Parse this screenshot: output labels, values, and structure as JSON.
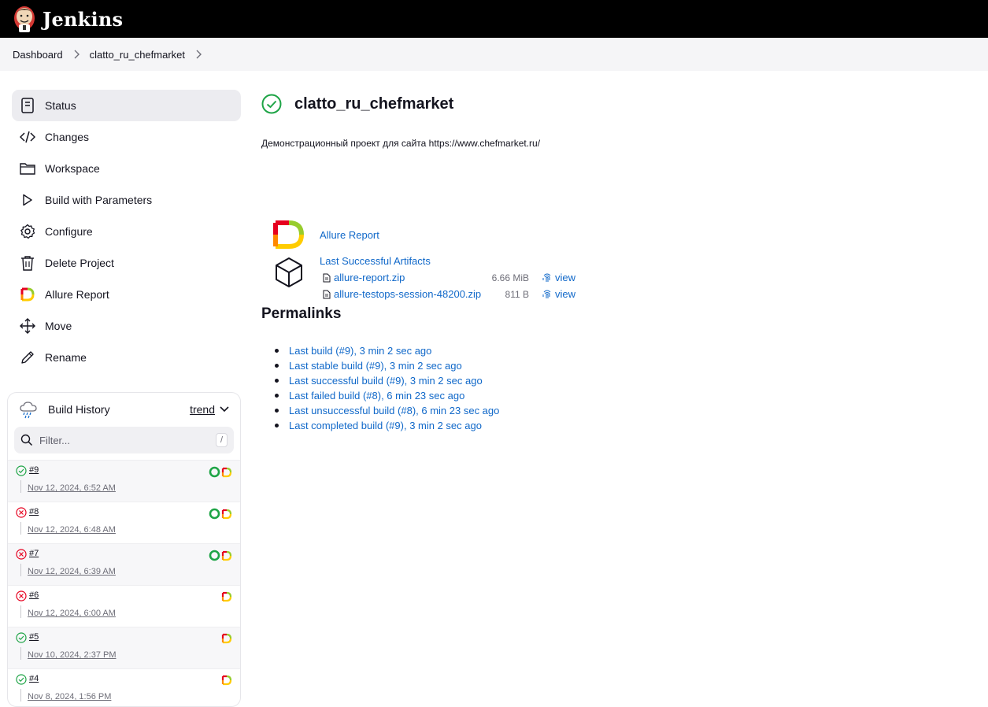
{
  "header": {
    "app_name": "Jenkins"
  },
  "breadcrumbs": [
    "Dashboard",
    "clatto_ru_chefmarket"
  ],
  "sidebar": {
    "items": [
      {
        "label": "Status",
        "icon": "status-icon"
      },
      {
        "label": "Changes",
        "icon": "code-icon"
      },
      {
        "label": "Workspace",
        "icon": "folder-icon"
      },
      {
        "label": "Build with Parameters",
        "icon": "play-icon"
      },
      {
        "label": "Configure",
        "icon": "gear-icon"
      },
      {
        "label": "Delete Project",
        "icon": "trash-icon"
      },
      {
        "label": "Allure Report",
        "icon": "allure-icon"
      },
      {
        "label": "Move",
        "icon": "move-icon"
      },
      {
        "label": "Rename",
        "icon": "pencil-icon"
      }
    ]
  },
  "build_history": {
    "title": "Build History",
    "trend_label": "trend",
    "filter_placeholder": "Filter...",
    "filter_shortcut": "/",
    "builds": [
      {
        "number": "#9",
        "date": "Nov 12, 2024, 6:52 AM",
        "status": "success",
        "testops": true
      },
      {
        "number": "#8",
        "date": "Nov 12, 2024, 6:48 AM",
        "status": "failed",
        "testops": true
      },
      {
        "number": "#7",
        "date": "Nov 12, 2024, 6:39 AM",
        "status": "failed",
        "testops": true
      },
      {
        "number": "#6",
        "date": "Nov 12, 2024, 6:00 AM",
        "status": "failed",
        "testops": false
      },
      {
        "number": "#5",
        "date": "Nov 10, 2024, 2:37 PM",
        "status": "success",
        "testops": false
      },
      {
        "number": "#4",
        "date": "Nov 8, 2024, 1:56 PM",
        "status": "success",
        "testops": false
      }
    ]
  },
  "main": {
    "title": "clatto_ru_chefmarket",
    "description": "Демонстрационный проект для сайта https://www.chefmarket.ru/",
    "allure_link": "Allure Report",
    "artifacts": {
      "title": "Last Successful Artifacts",
      "files": [
        {
          "name": "allure-report.zip",
          "size": "6.66 MiB",
          "view": "view"
        },
        {
          "name": "allure-testops-session-48200.zip",
          "size": "811 B",
          "view": "view"
        }
      ]
    },
    "permalinks_title": "Permalinks",
    "permalinks": [
      "Last build (#9), 3 min 2 sec ago",
      "Last stable build (#9), 3 min 2 sec ago",
      "Last successful build (#9), 3 min 2 sec ago",
      "Last failed build (#8), 6 min 23 sec ago",
      "Last unsuccessful build (#8), 6 min 23 sec ago",
      "Last completed build (#9), 3 min 2 sec ago"
    ]
  },
  "colors": {
    "success": "#1ea446",
    "failed": "#e6001f",
    "link": "#1068c9",
    "header_bg": "#000000",
    "active_nav_bg": "#ececf0"
  }
}
